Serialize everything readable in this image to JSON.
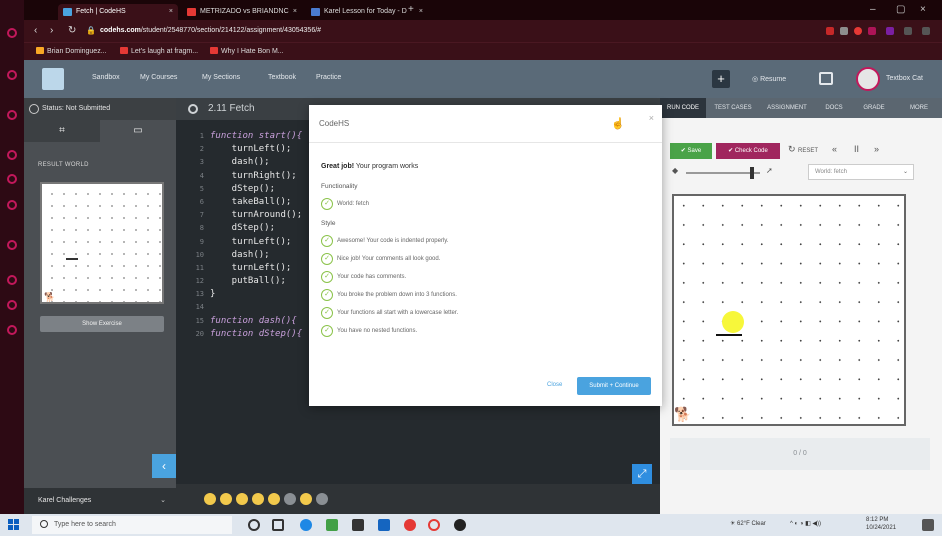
{
  "browser": {
    "tabs": [
      {
        "label": "Fetch | CodeHS",
        "active": true
      },
      {
        "label": "METRIZADO vs BRIANDNC",
        "active": false
      },
      {
        "label": "Karel Lesson for Today - D",
        "active": false
      }
    ],
    "url_host": "codehs.com",
    "url_path": "/student/2548770/section/214122/assignment/43054356/#",
    "bookmarks": [
      "Brian Dominguez...",
      "Let's laugh at fragm...",
      "Why I Hate Bon M..."
    ]
  },
  "app": {
    "nav": [
      "Sandbox",
      "My Courses",
      "My Sections",
      "Textbook",
      "Practice"
    ],
    "resume_label": "Resume",
    "user_name": "Textbox Cat"
  },
  "left": {
    "status": "Status: Not Submitted",
    "result_world_label": "RESULT WORLD",
    "show_button": "Show Exercise",
    "karel_label": "Karel Challenges"
  },
  "editor": {
    "file_title": "2.11 Fetch",
    "lines": [
      {
        "n": "1",
        "text": "function start(){"
      },
      {
        "n": "2",
        "text": "    turnLeft();"
      },
      {
        "n": "3",
        "text": "    dash();"
      },
      {
        "n": "4",
        "text": "    turnRight();"
      },
      {
        "n": "5",
        "text": "    dStep();"
      },
      {
        "n": "6",
        "text": "    takeBall();"
      },
      {
        "n": "7",
        "text": "    turnAround();"
      },
      {
        "n": "8",
        "text": "    dStep();"
      },
      {
        "n": "9",
        "text": "    turnLeft();"
      },
      {
        "n": "10",
        "text": "    dash();"
      },
      {
        "n": "11",
        "text": "    turnLeft();"
      },
      {
        "n": "12",
        "text": "    putBall();"
      },
      {
        "n": "13",
        "text": "}"
      },
      {
        "n": "14",
        "text": ""
      },
      {
        "n": "15",
        "text": "function dash(){"
      },
      {
        "n": "20",
        "text": "function dStep(){"
      }
    ]
  },
  "right": {
    "tabs": [
      "RUN CODE",
      "TEST CASES",
      "ASSIGNMENT",
      "DOCS",
      "GRADE",
      "MORE"
    ],
    "save": "Save",
    "check": "Check Code",
    "reset": "RESET",
    "world_select": "World: fetch",
    "status_bar": "0 / 0"
  },
  "modal": {
    "title": "CodeHS",
    "great_bold": "Great job!",
    "great_rest": " Your program works",
    "functionality_label": "Functionality",
    "functionality_items": [
      "World: fetch"
    ],
    "style_label": "Style",
    "style_items": [
      "Awesome! Your code is indented properly.",
      "Nice job! Your comments all look good.",
      "Your code has comments.",
      "You broke the problem down into 3 functions.",
      "Your functions all start with a lowercase letter.",
      "You have no nested functions."
    ],
    "close_label": "Close",
    "submit_label": "Submit + Continue"
  },
  "taskbar": {
    "search_placeholder": "Type here to search",
    "weather": "62°F Clear",
    "time": "8:12 PM",
    "date": "10/24/2021"
  },
  "colors": {
    "accent_blue": "#4aa3df",
    "save_green": "#4aa348",
    "check_magenta": "#a0265e",
    "header": "#5a6a78"
  }
}
